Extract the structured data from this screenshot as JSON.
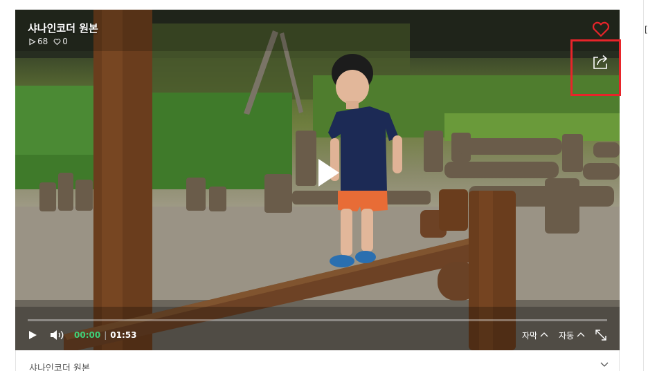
{
  "video": {
    "title": "샤나인코더 원본",
    "views": "68",
    "likes": "0",
    "progress_fraction": 0.0
  },
  "controls": {
    "current_time": "00:00",
    "separator": "|",
    "duration": "01:53",
    "caption_label": "자막",
    "auto_label": "자동"
  },
  "info_bar": {
    "title": "샤나인코더 원본"
  },
  "side": {
    "edge_mark": "["
  },
  "icons": {
    "like": "heart-icon",
    "share": "share-icon",
    "play": "play-icon",
    "volume": "volume-icon",
    "fullscreen": "fullscreen-icon",
    "chevron": "chevron-down-icon",
    "views": "play-outline-icon",
    "likes": "heart-outline-icon"
  },
  "colors": {
    "accent_time": "#3ed179",
    "like_red": "#e8242a",
    "highlight_red": "#e8242a"
  }
}
